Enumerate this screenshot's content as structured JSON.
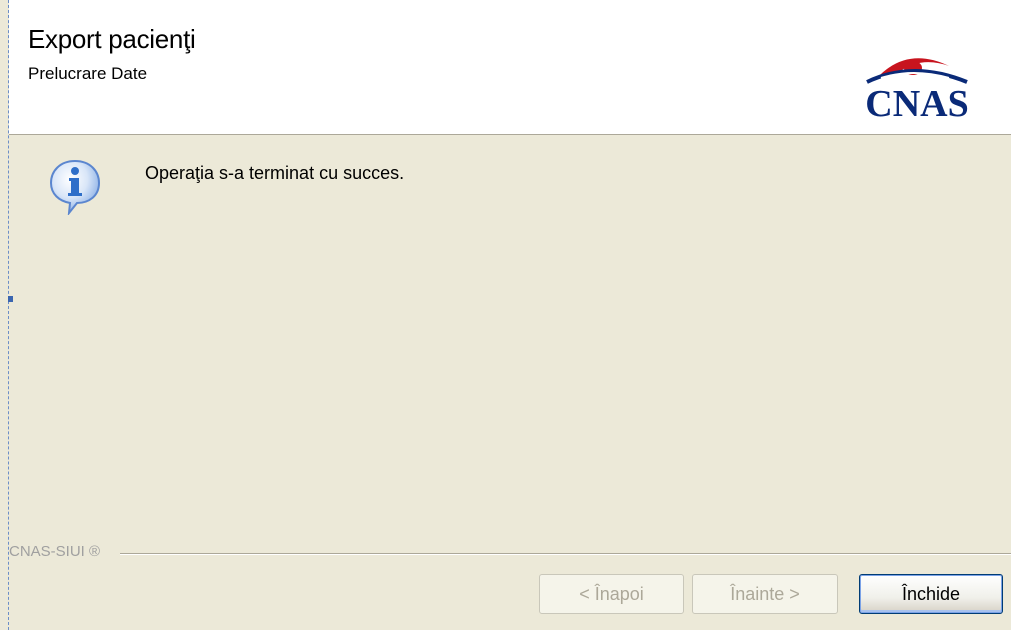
{
  "header": {
    "title": "Export pacienţi",
    "subtitle": "Prelucrare Date",
    "logo_text": "CNAS"
  },
  "content": {
    "icon": "info-icon",
    "message": "Operaţia s-a terminat cu succes."
  },
  "footer": {
    "brand": "CNAS-SIUI ®",
    "buttons": {
      "back": "< Înapoi",
      "next": "Înainte >",
      "close": "Închide"
    }
  },
  "colors": {
    "dialog_bg": "#ECE9D8",
    "header_bg": "#FFFFFF",
    "logo_blue": "#0A2A78",
    "logo_red": "#C8141E",
    "icon_blue": "#2F6FC9"
  }
}
